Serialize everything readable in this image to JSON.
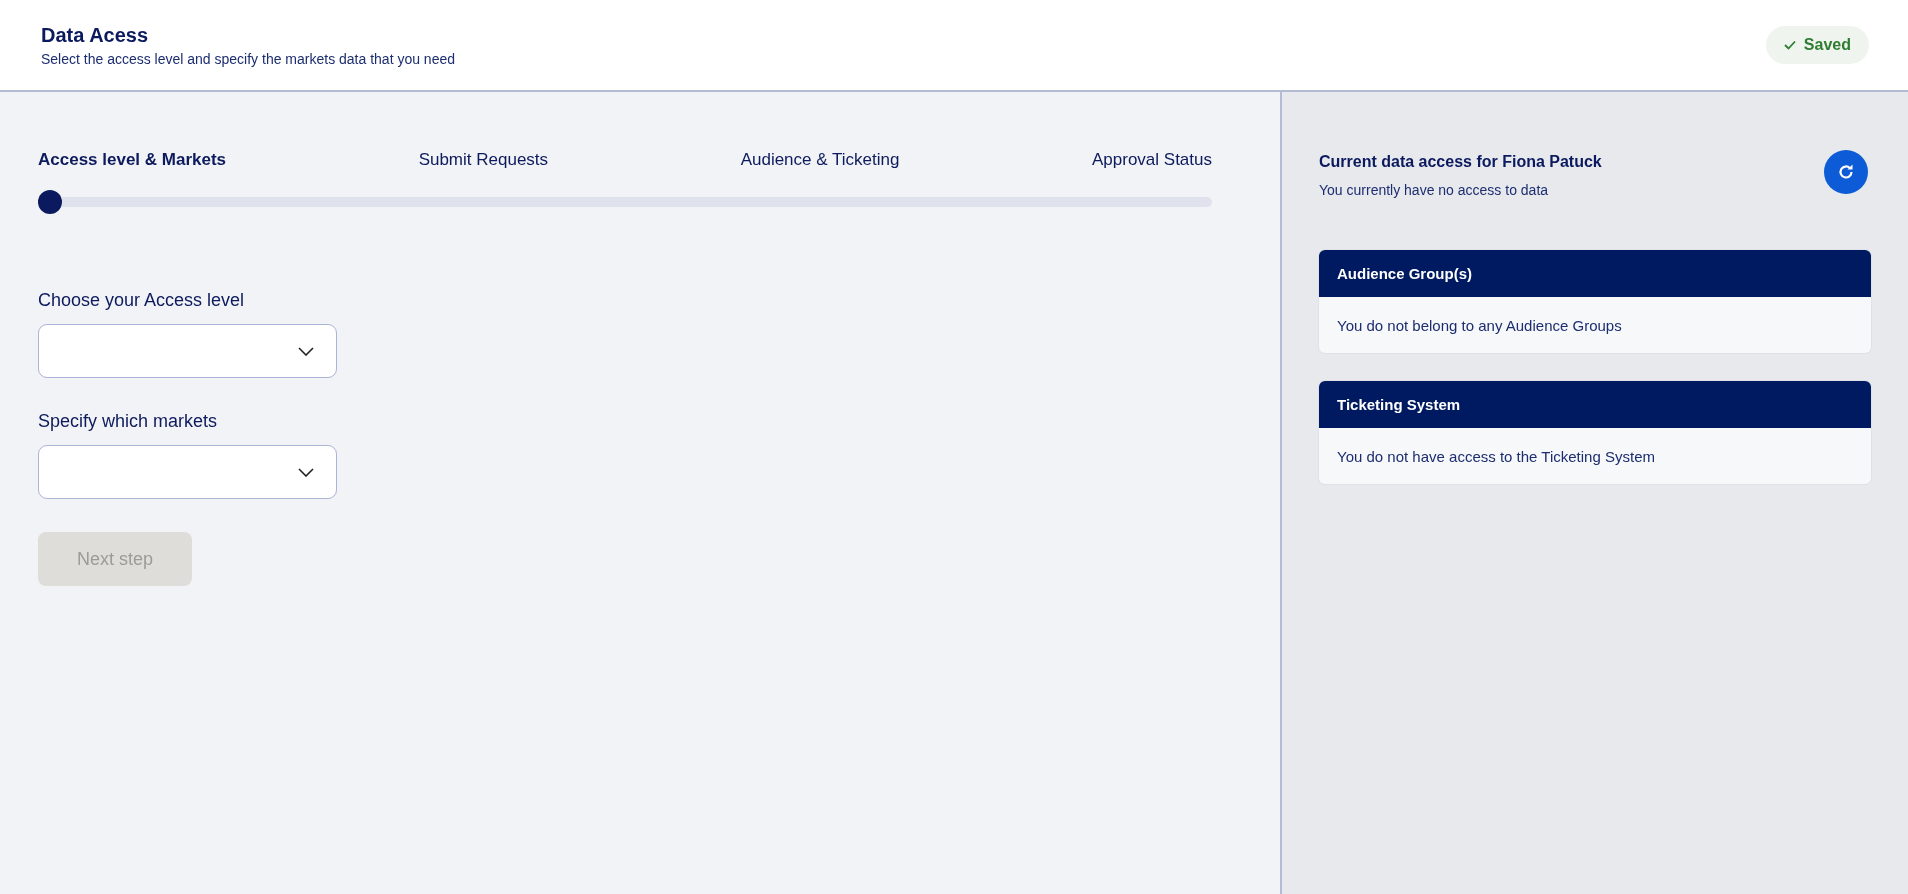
{
  "header": {
    "title": "Data Acess",
    "subtitle": "Select the access level and specify the markets data that you need",
    "status": {
      "label": "Saved",
      "saved": true
    }
  },
  "stepper": {
    "steps": [
      {
        "label": "Access level & Markets",
        "selected": true
      },
      {
        "label": "Submit Requests",
        "selected": false
      },
      {
        "label": "Audience & Ticketing",
        "selected": false
      },
      {
        "label": "Approval Status",
        "selected": false
      }
    ],
    "level": 0
  },
  "form": {
    "fields": [
      {
        "label": "Choose your Access level"
      },
      {
        "label": "Specify which markets"
      }
    ],
    "next_button": {
      "label": "Next step",
      "disabled": true
    }
  },
  "side_panel": {
    "title": "Current data access for Fiona Patuck",
    "subtitle": "You currently have no access to data",
    "cards": [
      {
        "title": "Audience Group(s)",
        "text": "You do not belong to any Audience Groups"
      },
      {
        "title": "Ticketing System",
        "text": "You do not have access to the Ticketing System"
      }
    ]
  }
}
